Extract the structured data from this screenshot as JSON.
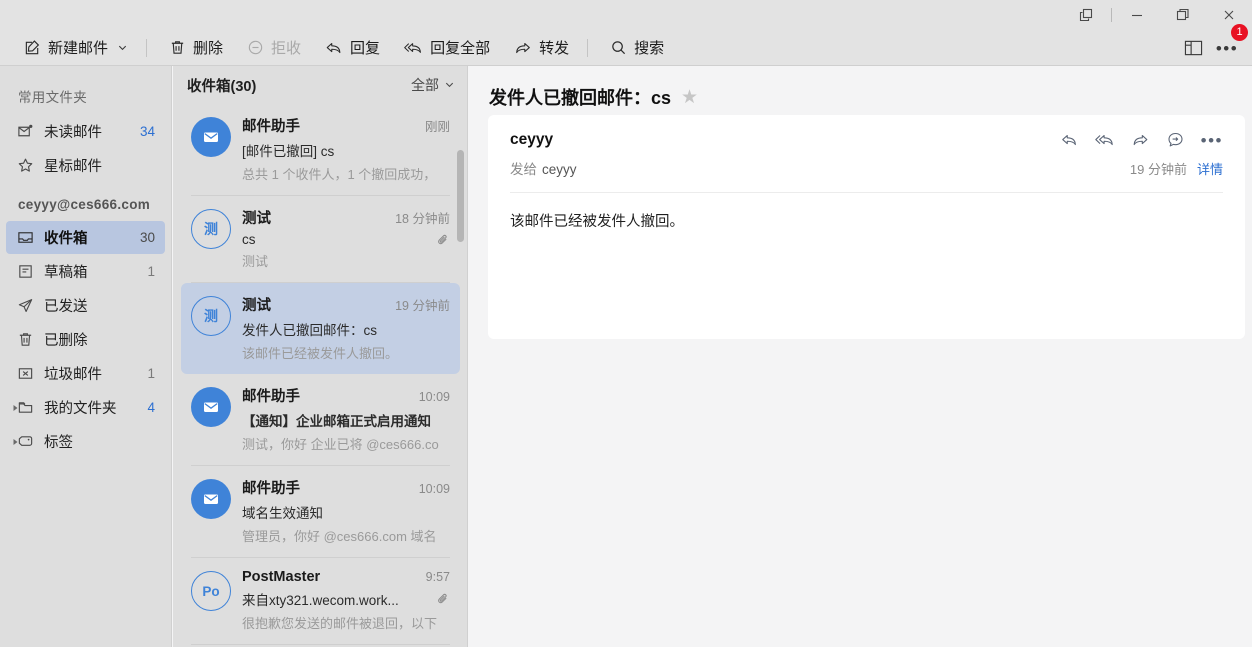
{
  "window": {
    "controls": [
      {
        "name": "popout",
        "icon": "popout-icon"
      },
      {
        "name": "minimize",
        "icon": "minimize-icon"
      },
      {
        "name": "maximize",
        "icon": "maximize-icon"
      },
      {
        "name": "close",
        "icon": "close-icon"
      }
    ]
  },
  "toolbar": {
    "compose_label": "新建邮件",
    "delete_label": "删除",
    "reject_label": "拒收",
    "reply_label": "回复",
    "reply_all_label": "回复全部",
    "forward_label": "转发",
    "search_label": "搜索",
    "layout_icon": "layout-panel-icon",
    "more_icon": "more-horizontal-icon",
    "more_badge": "1",
    "badge_color": "#e81123"
  },
  "sidebar": {
    "common_header": "常用文件夹",
    "common_items": [
      {
        "label": "未读邮件",
        "count": "34",
        "count_color": "blue",
        "icon": "unread-mail-icon"
      },
      {
        "label": "星标邮件",
        "count": "",
        "count_color": "gray",
        "icon": "star-icon"
      }
    ],
    "account": "ceyyy@ces666.com",
    "folders": [
      {
        "label": "收件箱",
        "count": "30",
        "count_color": "gray",
        "icon": "inbox-icon",
        "active": true
      },
      {
        "label": "草稿箱",
        "count": "1",
        "count_color": "gray",
        "icon": "draft-icon",
        "active": false
      },
      {
        "label": "已发送",
        "count": "",
        "count_color": "gray",
        "icon": "sent-icon",
        "active": false
      },
      {
        "label": "已删除",
        "count": "",
        "count_color": "gray",
        "icon": "trash-icon",
        "active": false
      },
      {
        "label": "垃圾邮件",
        "count": "1",
        "count_color": "gray",
        "icon": "junk-icon",
        "active": false
      }
    ],
    "groups": [
      {
        "label": "我的文件夹",
        "count": "4",
        "count_color": "blue",
        "icon": "folder-icon"
      },
      {
        "label": "标签",
        "count": "",
        "count_color": "gray",
        "icon": "tag-icon"
      }
    ]
  },
  "list": {
    "title": "收件箱(30)",
    "filter_label": "全部",
    "messages": [
      {
        "avatar_type": "filled",
        "avatar_text": "",
        "avatar_color": "#3f83d8",
        "from": "邮件助手",
        "time": "刚刚",
        "subject": "[邮件已撤回] cs",
        "subject_bold": false,
        "preview": "总共 1 个收件人，1 个撤回成功，",
        "attachment": false,
        "selected": false
      },
      {
        "avatar_type": "outline",
        "avatar_text": "测",
        "avatar_color": "#3f83d8",
        "from": "测试",
        "time": "18 分钟前",
        "subject": "cs",
        "subject_bold": false,
        "preview": "测试",
        "attachment": true,
        "selected": false
      },
      {
        "avatar_type": "outline",
        "avatar_text": "测",
        "avatar_color": "#3f83d8",
        "from": "测试",
        "time": "19 分钟前",
        "subject": "发件人已撤回邮件：cs",
        "subject_bold": false,
        "preview": "该邮件已经被发件人撤回。",
        "attachment": false,
        "selected": true
      },
      {
        "avatar_type": "filled",
        "avatar_text": "",
        "avatar_color": "#3f83d8",
        "from": "邮件助手",
        "time": "10:09",
        "subject": "【通知】企业邮箱正式启用通知",
        "subject_bold": true,
        "preview": "测试，你好 企业已将 @ces666.co",
        "attachment": false,
        "selected": false
      },
      {
        "avatar_type": "filled",
        "avatar_text": "",
        "avatar_color": "#3f83d8",
        "from": "邮件助手",
        "time": "10:09",
        "subject": "域名生效通知",
        "subject_bold": false,
        "preview": "管理员，你好 @ces666.com 域名",
        "attachment": false,
        "selected": false
      },
      {
        "avatar_type": "outline",
        "avatar_text": "Po",
        "avatar_color": "#3f83d8",
        "from": "PostMaster",
        "time": "9:57",
        "subject": "来自xty321.wecom.work...",
        "subject_bold": false,
        "preview": "很抱歉您发送的邮件被退回，以下",
        "attachment": true,
        "selected": false
      }
    ]
  },
  "reader": {
    "subject": "发件人已撤回邮件：cs",
    "star_icon": "star-outline-icon",
    "sender": "ceyyy",
    "to_label": "发给",
    "to_value": "ceyyy",
    "time": "19 分钟前",
    "details_label": "详情",
    "details_color": "#2c6fd1",
    "actions": [
      {
        "name": "reply-icon"
      },
      {
        "name": "reply-all-icon"
      },
      {
        "name": "forward-icon"
      },
      {
        "name": "quick-reply-icon"
      },
      {
        "name": "more-horizontal-icon"
      }
    ],
    "body": "该邮件已经被发件人撤回。"
  }
}
